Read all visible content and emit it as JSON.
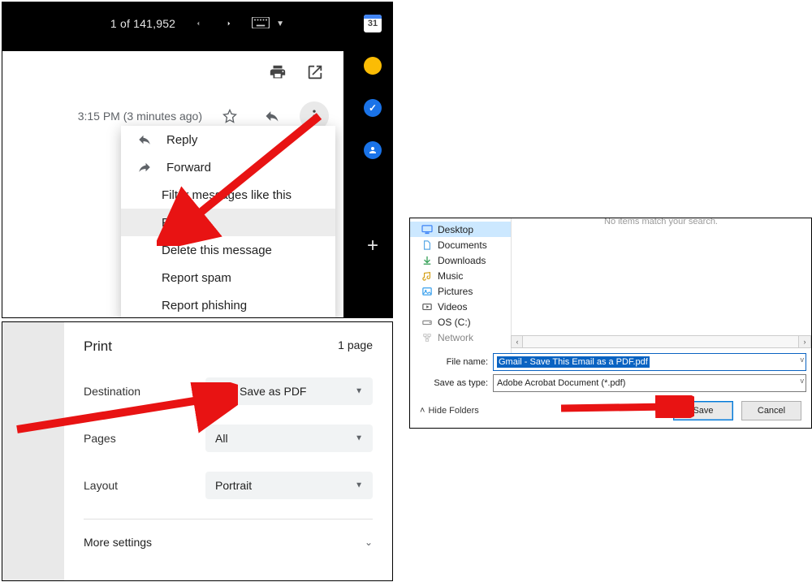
{
  "cal_day": "31",
  "gmail": {
    "counter": "1 of 141,952",
    "timestamp": "3:15 PM (3 minutes ago)",
    "menu": {
      "reply": "Reply",
      "forward": "Forward",
      "filter": "Filter messages like this",
      "print": "Print",
      "delete": "Delete this message",
      "report_spam": "Report spam",
      "report_phishing": "Report phishing"
    }
  },
  "print": {
    "title": "Print",
    "page_count": "1 page",
    "destination_label": "Destination",
    "destination_value": "Save as PDF",
    "pages_label": "Pages",
    "pages_value": "All",
    "layout_label": "Layout",
    "layout_value": "Portrait",
    "more_settings": "More settings"
  },
  "save": {
    "no_items": "No items match your search.",
    "tree": {
      "desktop": "Desktop",
      "documents": "Documents",
      "downloads": "Downloads",
      "music": "Music",
      "pictures": "Pictures",
      "videos": "Videos",
      "osc": "OS (C:)",
      "network": "Network"
    },
    "file_name_label": "File name:",
    "file_name_value": "Gmail - Save This Email as a PDF.pdf",
    "save_as_type_label": "Save as type:",
    "save_as_type_value": "Adobe Acrobat Document (*.pdf)",
    "hide_folders": "Hide Folders",
    "save_button": "Save",
    "cancel_button": "Cancel"
  }
}
